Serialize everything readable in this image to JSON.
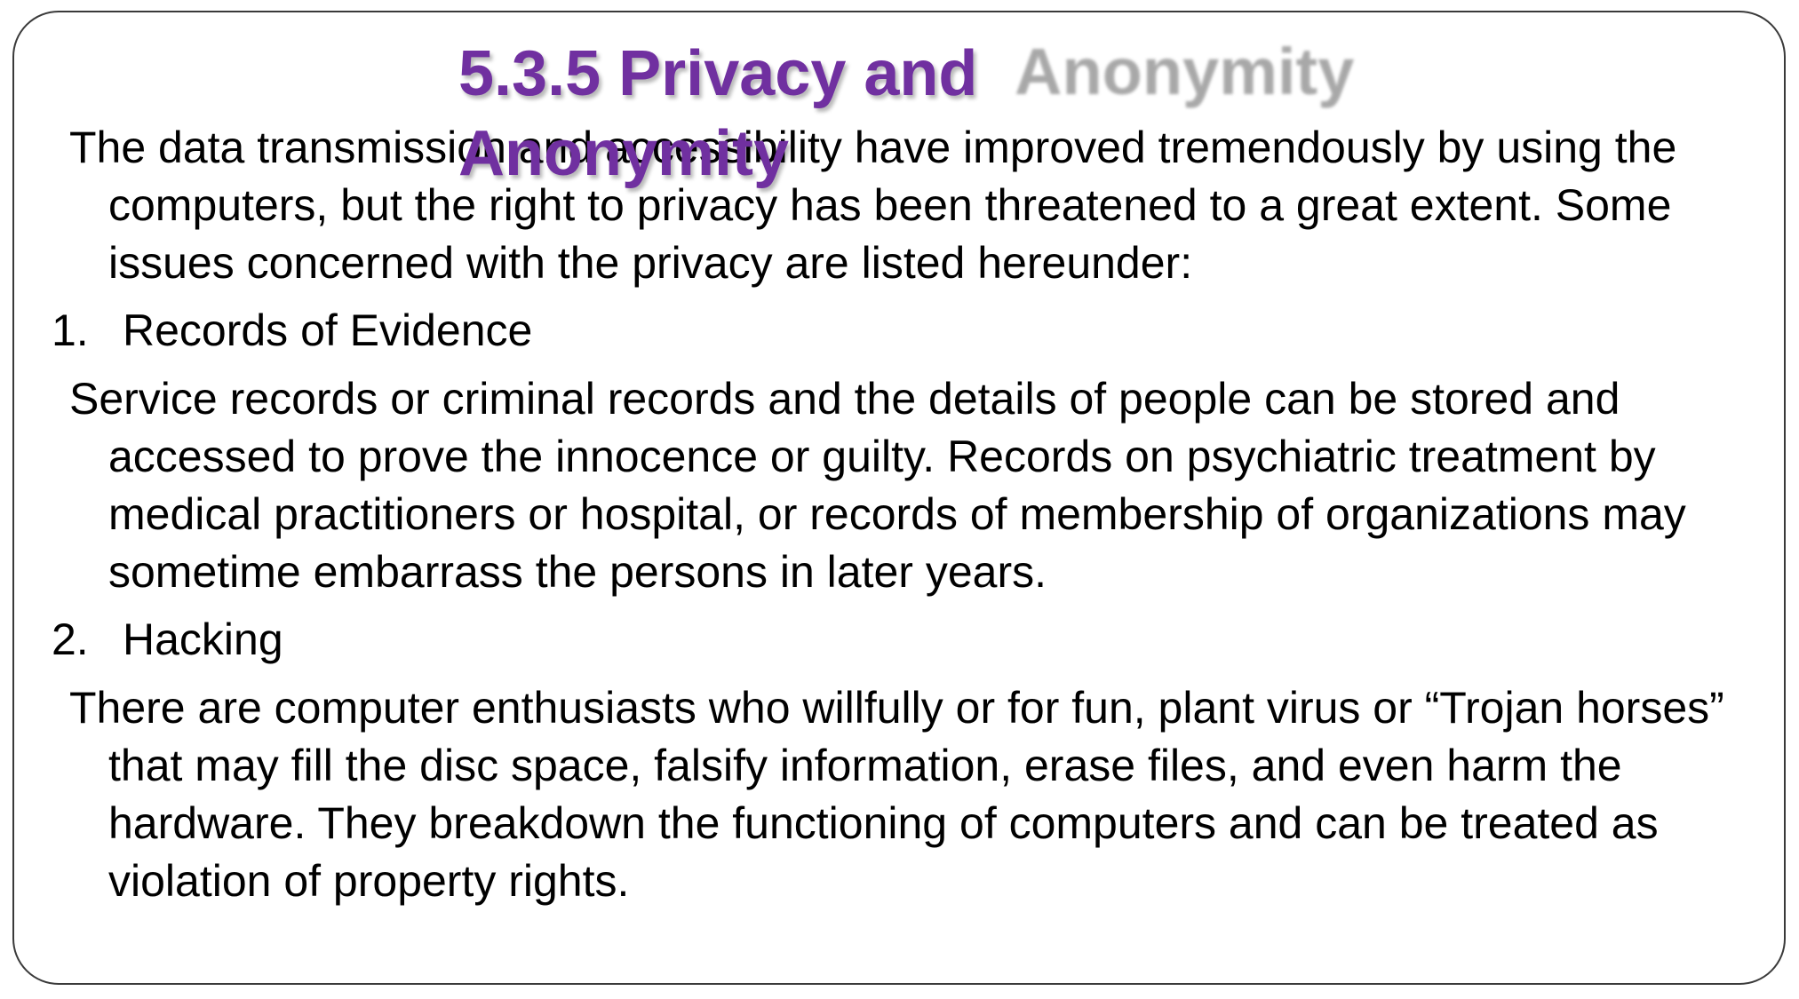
{
  "slide": {
    "title": "5.3.5 Privacy and Anonymity",
    "title_shadow_text": "Anonymity",
    "intro": "The data transmission and accessibility have improved tremendously by using the computers, but the right to privacy has been threatened to a great extent. Some issues concerned with the privacy are listed hereunder:",
    "items": [
      {
        "number": "1.",
        "heading": "Records of Evidence",
        "text": "Service records or criminal records and the details of people can be stored and accessed to prove the innocence or guilty. Records on psychiatric treatment by medical practitioners or hospital, or records of membership of organizations may sometime embarrass the persons in later years."
      },
      {
        "number": "2.",
        "heading": "Hacking",
        "text": "There are computer enthusiasts who willfully or for fun, plant virus or “Trojan horses” that may fill the disc space, falsify information, erase files, and even harm the hardware. They breakdown the functioning of computers and can be treated as violation of property rights."
      }
    ]
  },
  "colors": {
    "title": "#7030a0",
    "body_text": "#000000",
    "frame_border": "#3a3a3a",
    "background": "#ffffff"
  }
}
